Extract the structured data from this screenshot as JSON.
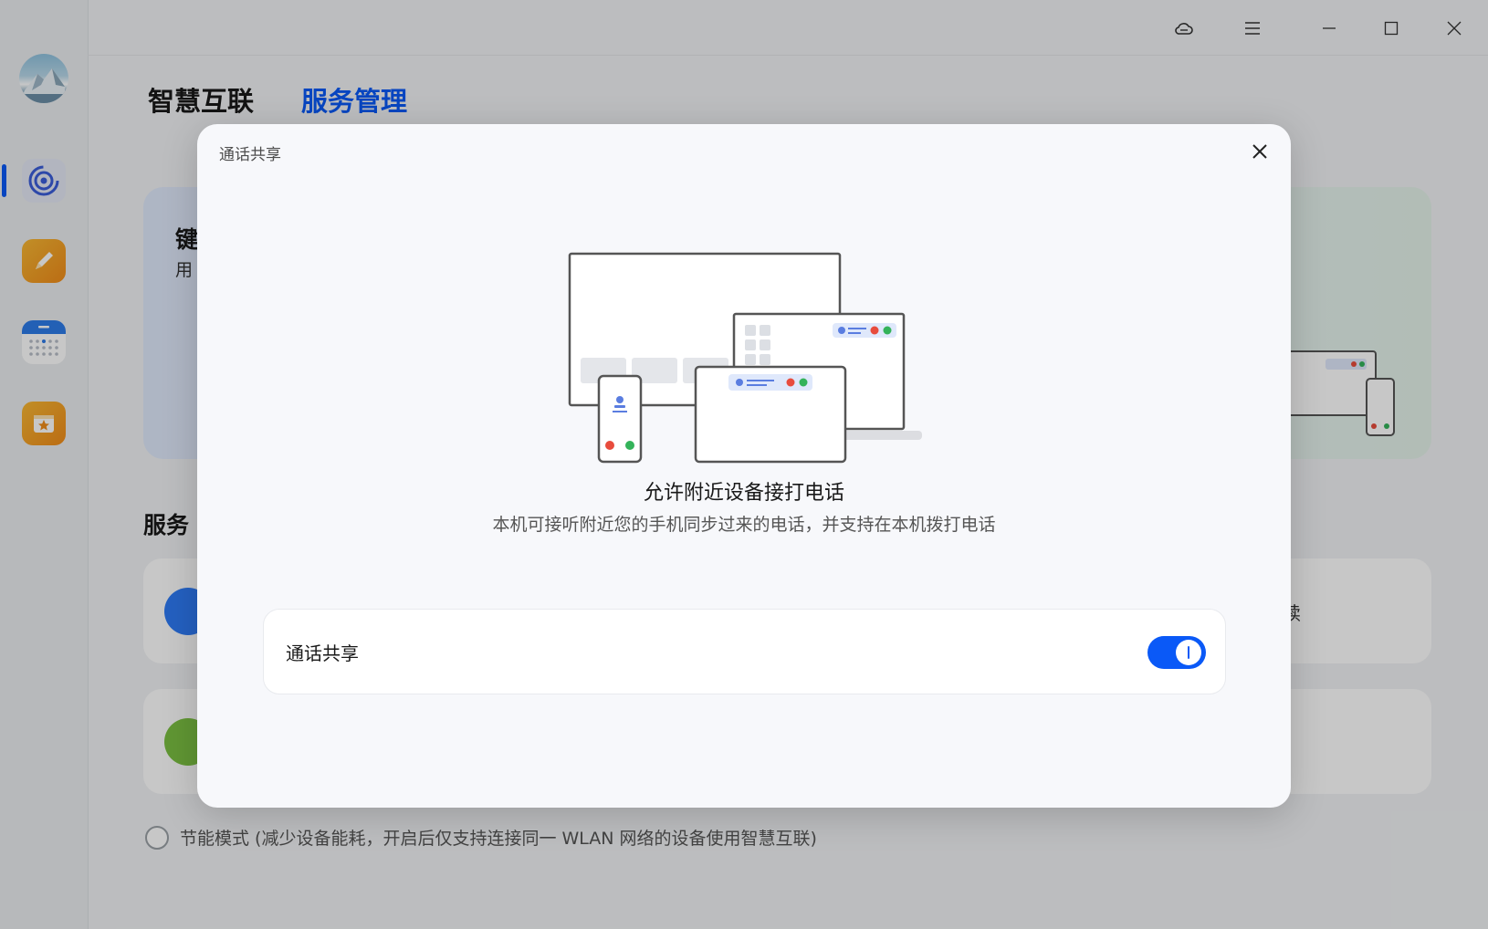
{
  "app": {
    "tabs": [
      {
        "label": "智慧互联"
      },
      {
        "label": "服务管理"
      }
    ],
    "active_tab": "服务管理",
    "hero": {
      "title": "键",
      "subtitle": "用"
    },
    "section_title": "服务",
    "services": [
      {
        "tail_label": "续",
        "icon": "screen-share-icon",
        "color": "#2f7cf6"
      },
      {
        "icon": "audio-icon",
        "color": "#7cc142"
      }
    ],
    "power_mode_label": "节能模式 (减少设备能耗，开启后仅支持连接同一 WLAN 网络的设备使用智慧互联)"
  },
  "sidebar": {
    "items": [
      {
        "icon": "connect-icon",
        "color": "#3a5dd9"
      },
      {
        "icon": "notes-icon",
        "color": "#f2a623"
      },
      {
        "icon": "calendar-icon",
        "color": "#2d7be8"
      },
      {
        "icon": "favorites-icon",
        "color": "#f2a623"
      }
    ]
  },
  "titlebar": {
    "icons": [
      "cloud-icon",
      "menu-icon",
      "minimize-icon",
      "maximize-icon",
      "close-icon"
    ]
  },
  "dialog": {
    "title": "通话共享",
    "heading": "允许附近设备接打电话",
    "description": "本机可接听附近您的手机同步过来的电话，并支持在本机拨打电话",
    "toggle": {
      "label": "通话共享",
      "state": "on",
      "color": "#0a59f7"
    }
  }
}
